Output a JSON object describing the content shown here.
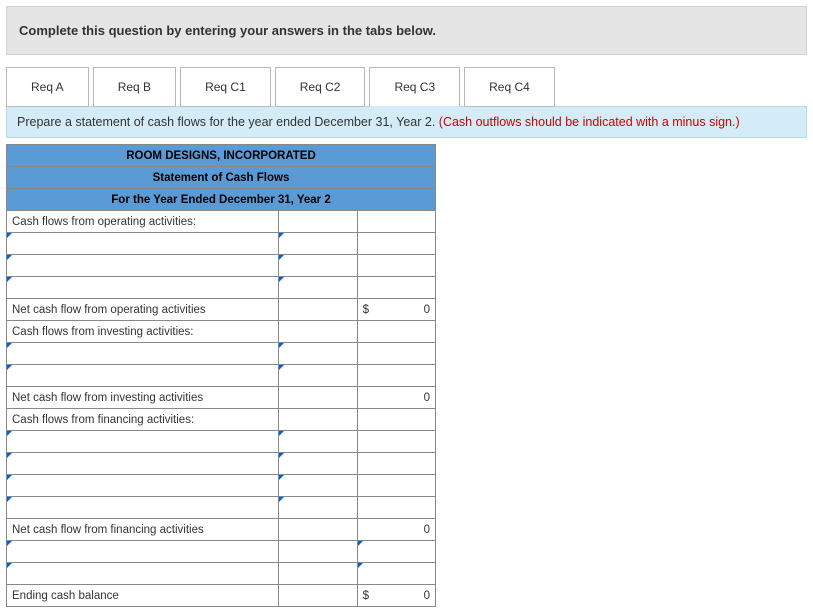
{
  "instructions": "Complete this question by entering your answers in the tabs below.",
  "tabs": [
    "Req A",
    "Req B",
    "Req C1",
    "Req C2",
    "Req C3",
    "Req C4"
  ],
  "activeTab": 4,
  "subInstructions": {
    "main": "Prepare a statement of cash flows for the year ended December 31, Year 2. ",
    "warn": "(Cash outflows should be indicated with a minus sign.)"
  },
  "header": {
    "company": "ROOM DESIGNS, INCORPORATED",
    "title": "Statement of Cash Flows",
    "period": "For the Year Ended December 31, Year 2"
  },
  "rows": {
    "op_section": "Cash flows from operating activities:",
    "op_net": "Net cash flow from operating activities",
    "inv_section": "Cash flows from investing activities:",
    "inv_net": "Net cash flow from investing activities",
    "fin_section": "Cash flows from financing activities:",
    "fin_net": "Net cash flow from financing activities",
    "ending": "Ending cash balance"
  },
  "vals": {
    "dollar": "$",
    "zero": "0"
  }
}
